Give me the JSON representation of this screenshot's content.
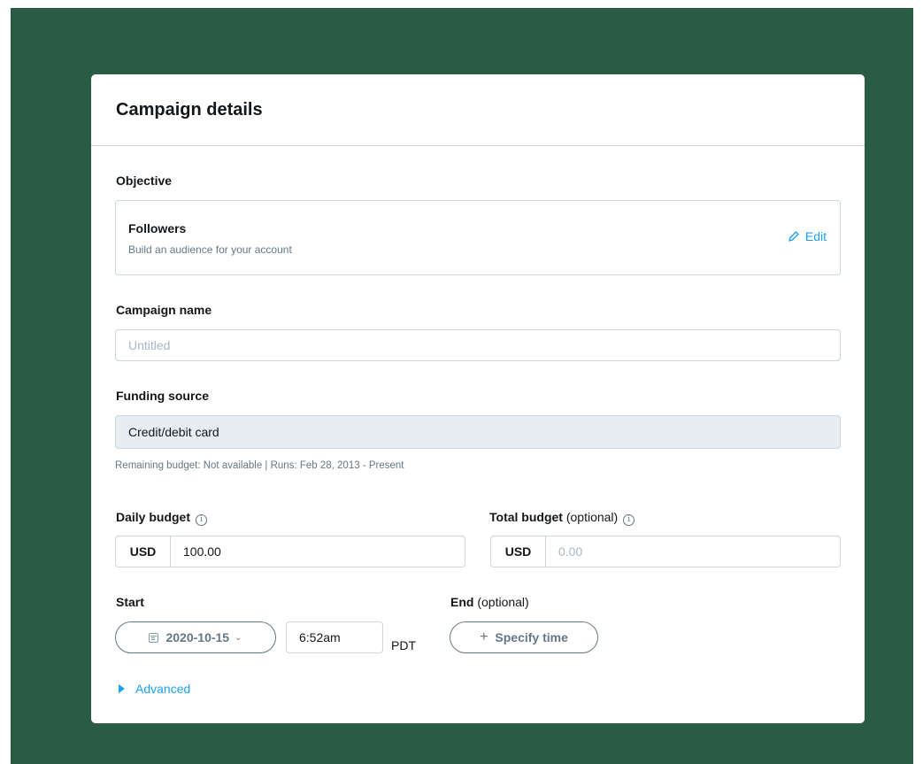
{
  "card": {
    "title": "Campaign details"
  },
  "objective": {
    "label": "Objective",
    "title": "Followers",
    "subtitle": "Build an audience for your account",
    "edit_label": "Edit"
  },
  "campaign_name": {
    "label": "Campaign name",
    "placeholder": "Untitled",
    "value": ""
  },
  "funding": {
    "label": "Funding source",
    "value": "Credit/debit card",
    "helper": "Remaining budget: Not available | Runs: Feb 28, 2013 - Present"
  },
  "daily_budget": {
    "label": "Daily budget",
    "currency": "USD",
    "value": "100.00"
  },
  "total_budget": {
    "label": "Total budget",
    "optional": "(optional)",
    "currency": "USD",
    "placeholder": "0.00"
  },
  "start": {
    "label": "Start",
    "date": "2020-10-15",
    "time": "6:52am",
    "timezone": "PDT"
  },
  "end": {
    "label": "End",
    "optional": "(optional)",
    "button_label": "Specify time"
  },
  "advanced": {
    "label": "Advanced"
  },
  "colors": {
    "background": "#2a5b45",
    "accent": "#1da1f2",
    "muted": "#657786"
  },
  "icons": [
    "info-icon",
    "pencil-icon",
    "calendar-icon",
    "chevron-down-icon",
    "plus-icon",
    "triangle-right-icon"
  ]
}
